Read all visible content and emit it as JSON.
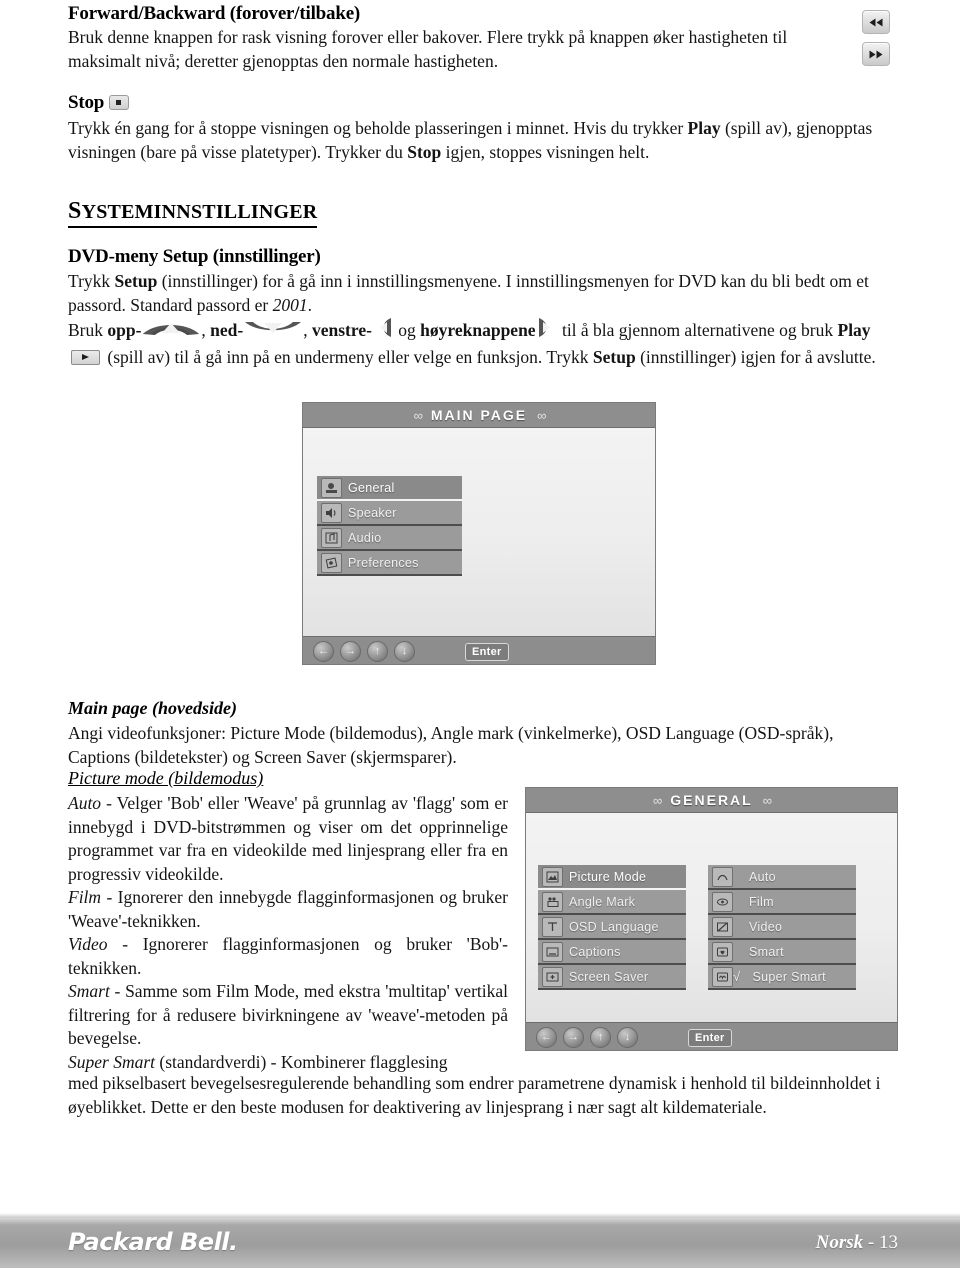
{
  "doc": {
    "sections": {
      "forward": {
        "heading": "Forward/Backward (forover/tilbake)",
        "body": "Bruk denne knappen for rask visning forover eller bakover.  Flere trykk på knappen øker hastigheten til maksimalt nivå; deretter gjenopptas den normale hastigheten."
      },
      "stop": {
        "heading": "Stop",
        "body_1": "Trykk én gang for å stoppe visningen og beholde plasseringen i minnet.  Hvis du trykker ",
        "play_bold": "Play",
        "body_2": " (spill av), gjenopptas visningen (bare på visse platetyper).  Trykker du ",
        "stop_bold": "Stop",
        "body_3": " igjen, stoppes visningen helt."
      },
      "systeminnstillinger": {
        "title_first": "S",
        "title_rest": "YSTEMINNSTILLINGER"
      },
      "dvdmeny": {
        "heading": "DVD-meny Setup (innstillinger)",
        "body_1": "Trykk ",
        "setup_bold": "Setup",
        "body_2": " (innstillinger) for å gå inn i innstillingsmenyene. I innstillingsmenyen for DVD kan du bli bedt om et passord.  Standard passord er ",
        "password": "2001",
        "body_3": "."
      },
      "navigation": {
        "lead": "Bruk ",
        "opp": "opp-",
        "ned": "ned-",
        "venstre": "venstre-",
        "og": "og ",
        "hoyre": "høyreknappene",
        "tail_1": " til å bla gjennom alternativene og bruk ",
        "play_bold": "Play",
        "tail_2": " (spill av) til å gå inn på en undermeny eller velge en funksjon. Trykk ",
        "setup_bold": "Setup",
        "tail_3": " (innstillinger) igjen for å avslutte."
      },
      "mainpage": {
        "heading": "Main page (hovedside)",
        "body": "Angi videofunksjoner: Picture Mode (bildemodus), Angle mark (vinkelmerke), OSD Language (OSD-språk), Captions (bildetekster) og Screen Saver (skjermsparer)."
      },
      "picturemode": {
        "heading": "Picture mode (bildemodus)",
        "entries": [
          {
            "term": "Auto",
            "text": " - Velger 'Bob' eller 'Weave' på grunnlag av 'flagg' som er innebygd i DVD-bitstrømmen og viser om det opprinnelige programmet var fra en videokilde med linjesprang eller fra en progressiv videokilde."
          },
          {
            "term": "Film",
            "text": " - Ignorerer den innebygde flagginformasjonen og bruker 'Weave'-teknikken."
          },
          {
            "term": "Video",
            "text": " - Ignorerer flagginformasjonen og bruker 'Bob'-teknikken."
          },
          {
            "term": "Smart",
            "text": " - Samme som Film Mode, med ekstra 'multitap' vertikal filtrering for å redusere bivirkningene av 'weave'-metoden på bevegelse."
          },
          {
            "term": "Super Smart",
            "text": " (standardverdi) - Kombinerer flagglesing"
          }
        ],
        "tail": "med pikselbasert bevegelsesregulerende behandling som endrer parametrene dynamisk i henhold til bildeinnholdet i øyeblikket. Dette er den beste modusen for deaktivering av linjesprang i nær sagt alt kildemateriale."
      }
    }
  },
  "osd_main": {
    "title": "MAIN PAGE",
    "chain_left": "∞",
    "chain_right": "∞",
    "items": [
      {
        "label": "General",
        "icon": "general-icon",
        "selected": true
      },
      {
        "label": "Speaker",
        "icon": "speaker-icon",
        "selected": false
      },
      {
        "label": "Audio",
        "icon": "audio-icon",
        "selected": false
      },
      {
        "label": "Preferences",
        "icon": "preferences-icon",
        "selected": false
      }
    ],
    "footer": {
      "left_arrow": "←",
      "right_arrow": "→",
      "up_arrow": "↑",
      "down_arrow": "↓",
      "enter": "Enter"
    }
  },
  "osd_general": {
    "title": "GENERAL",
    "chain_left": "∞",
    "chain_right": "∞",
    "left_items": [
      {
        "label": "Picture Mode",
        "icon": "picture-mode-icon",
        "selected": true
      },
      {
        "label": "Angle Mark",
        "icon": "angle-mark-icon",
        "selected": false
      },
      {
        "label": "OSD Language",
        "icon": "osd-language-icon",
        "selected": false
      },
      {
        "label": "Captions",
        "icon": "captions-icon",
        "selected": false
      },
      {
        "label": "Screen Saver",
        "icon": "screen-saver-icon",
        "selected": false
      }
    ],
    "right_items": [
      {
        "label": "Auto",
        "icon": "auto-icon",
        "checked": false
      },
      {
        "label": "Film",
        "icon": "film-icon",
        "checked": false
      },
      {
        "label": "Video",
        "icon": "video-icon",
        "checked": false
      },
      {
        "label": "Smart",
        "icon": "smart-icon",
        "checked": false
      },
      {
        "label": "Super Smart",
        "icon": "super-smart-icon",
        "checked": true
      }
    ],
    "footer": {
      "left_arrow": "←",
      "right_arrow": "→",
      "up_arrow": "↑",
      "down_arrow": "↓",
      "enter": "Enter"
    }
  },
  "footer": {
    "brand": "Packard Bell.",
    "language": "Norsk",
    "separator": " - ",
    "page_number": "13"
  },
  "colors": {
    "osd_bar": "#8e8e8e",
    "osd_item": "#9b9b9b",
    "footer_bar": "#a8a8a8"
  }
}
